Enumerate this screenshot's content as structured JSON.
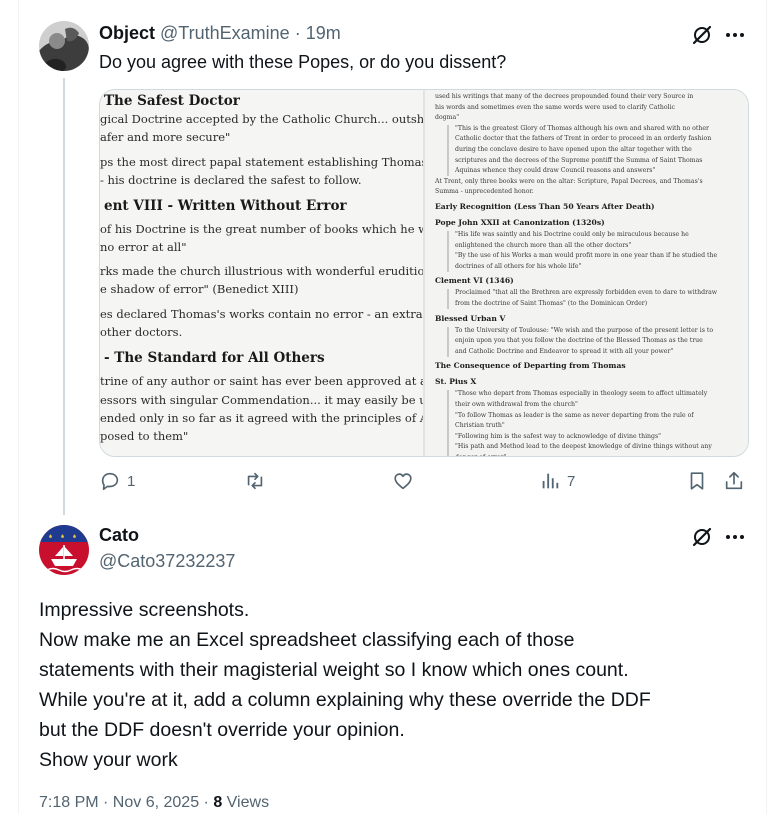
{
  "tweet1": {
    "author_name": "Object",
    "author_handle": "@TruthExamine",
    "separator": "·",
    "time": "19m",
    "text": "Do you agree with these Popes, or do you dissent?",
    "actions": {
      "reply_count": "1",
      "views_count": "7"
    },
    "media": {
      "left_lines": [
        {
          "kind": "h",
          "text": "The Safest Doctor"
        },
        {
          "kind": "p",
          "text": "gical Doctrine accepted by the Catholic Church... outshines eve"
        },
        {
          "kind": "p",
          "text": "afer and more secure\""
        },
        {
          "kind": "p",
          "text": "ps the most direct papal statement establishing Thomas as uniq"
        },
        {
          "kind": "p",
          "text": "- his doctrine is declared the safest to follow."
        },
        {
          "kind": "h",
          "text": "ent VIII - Written Without Error"
        },
        {
          "kind": "p",
          "text": "of his Doctrine is the great number of books which he wrote in a"
        },
        {
          "kind": "p",
          "text": "no error at all\""
        },
        {
          "kind": "p",
          "text": "rks made the church illustrious with wonderful erudition... and"
        },
        {
          "kind": "p",
          "text": "e shadow of error\" (Benedict XIII)"
        },
        {
          "kind": "p",
          "text": "es declared Thomas's works contain no error - an extraordinary"
        },
        {
          "kind": "p",
          "text": "other doctors."
        },
        {
          "kind": "h",
          "text": "- The Standard for All Others"
        },
        {
          "kind": "p",
          "text": "trine of any author or saint has ever been approved at any time"
        },
        {
          "kind": "p",
          "text": "essors with singular Commendation... it may easily be underst"
        },
        {
          "kind": "p",
          "text": "ended only in so far as it agreed with the principles of Aquinas"
        },
        {
          "kind": "p",
          "text": "posed to them\""
        }
      ],
      "right_lines": [
        {
          "kind": "p",
          "text": "used his writings that many of the decrees propounded found their very Source in"
        },
        {
          "kind": "p",
          "text": "his words and sometimes even the same words were used to clarify Catholic"
        },
        {
          "kind": "p",
          "text": "dogma\""
        },
        {
          "kind": "q",
          "text": "\"This is the greatest Glory of Thomas although his own and shared with no other"
        },
        {
          "kind": "q",
          "text": "Catholic doctor that the fathers of Trent in order to proceed in an orderly fashion"
        },
        {
          "kind": "q",
          "text": "during the conclave desire to have opened upon the altar together with the"
        },
        {
          "kind": "q",
          "text": "scriptures and the decrees of the Supreme pontiff the Summa of Saint Thomas"
        },
        {
          "kind": "q",
          "text": "Aquinas whence they could draw Council reasons and answers\""
        },
        {
          "kind": "p",
          "text": "At Trent, only three books were on the altar: Scripture, Papal Decrees, and Thomas's"
        },
        {
          "kind": "p",
          "text": "Summa - unprecedented honor."
        },
        {
          "kind": "h",
          "text": "Early Recognition (Less Than 50 Years After Death)"
        },
        {
          "kind": "h",
          "text": "Pope John XXII at Canonization (1320s)"
        },
        {
          "kind": "q",
          "text": "\"His life was saintly and his Doctrine could only be miraculous because he"
        },
        {
          "kind": "q",
          "text": "enlightened the church more than all the other doctors\""
        },
        {
          "kind": "q",
          "text": "\"By the use of his Works a man would profit more in one year than if he studied the"
        },
        {
          "kind": "q",
          "text": "doctrines of all others for his whole life\""
        },
        {
          "kind": "h",
          "text": "Clement VI (1346)"
        },
        {
          "kind": "q",
          "text": "Proclaimed \"that all the Brethren are expressly forbidden even to dare to withdraw"
        },
        {
          "kind": "q",
          "text": "from the doctrine of Saint Thomas\" (to the Dominican Order)"
        },
        {
          "kind": "h",
          "text": "Blessed Urban V"
        },
        {
          "kind": "q",
          "text": "To the University of Toulouse: \"We wish and the purpose of the present letter is to"
        },
        {
          "kind": "q",
          "text": "enjoin upon you that you follow the doctrine of the Blessed Thomas as the true"
        },
        {
          "kind": "q",
          "text": "and Catholic Doctrine and Endeavor to spread it with all your power\""
        },
        {
          "kind": "h",
          "text": "The Consequence of Departing from Thomas"
        },
        {
          "kind": "h",
          "text": "St. Pius X"
        },
        {
          "kind": "q",
          "text": "\"Those who depart from Thomas especially in theology seem to affect ultimately"
        },
        {
          "kind": "q",
          "text": "their own withdrawal from the church\""
        },
        {
          "kind": "q",
          "text": "\"To follow Thomas as leader is the same as never departing from the rule of"
        },
        {
          "kind": "q",
          "text": "Christian truth\""
        },
        {
          "kind": "q",
          "text": "\"Following him is the safest way to acknowledge of divine things\""
        },
        {
          "kind": "q",
          "text": "\"His path and Method lead to the deepest knowledge of divine things without any"
        },
        {
          "kind": "q",
          "text": "danger of error\""
        }
      ]
    }
  },
  "tweet2": {
    "author_name": "Cato",
    "author_handle": "@Cato37232237",
    "lines": [
      "Impressive screenshots.",
      "Now make me an Excel spreadsheet classifying each of those",
      "statements with their magisterial weight so I know which ones count.",
      "While you're at it, add a column explaining why these override the DDF",
      "but the DDF doesn't override your opinion.",
      "Show your work"
    ],
    "timestamp": "7:18 PM · Nov 6, 2025 ·",
    "views_count": "8",
    "views_label": "Views"
  },
  "colors": {
    "text": "#0f1419",
    "muted": "#536471",
    "border": "#cfd9de",
    "avatar2_red": "#c8102e",
    "avatar2_blue": "#1f3b8f"
  },
  "icons": [
    "grok-icon",
    "more-icon",
    "reply-icon",
    "retweet-icon",
    "like-icon",
    "views-icon",
    "bookmark-icon",
    "share-icon"
  ]
}
